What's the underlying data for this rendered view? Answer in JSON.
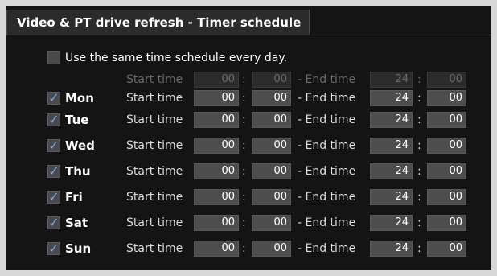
{
  "title": "Video & PT drive refresh - Timer schedule",
  "same_schedule": {
    "label": "Use the same time schedule every day.",
    "checked": false,
    "start_label": "Start time",
    "start_hour": "00",
    "start_minute": "00",
    "end_label": "- End time",
    "end_hour": "24",
    "end_minute": "00",
    "colon": ":"
  },
  "days": [
    {
      "name": "Mon",
      "checked": true,
      "start_label": "Start time",
      "start_hour": "00",
      "start_minute": "00",
      "end_label": "- End time",
      "end_hour": "24",
      "end_minute": "00",
      "colon": ":"
    },
    {
      "name": "Tue",
      "checked": true,
      "start_label": "Start time",
      "start_hour": "00",
      "start_minute": "00",
      "end_label": "- End time",
      "end_hour": "24",
      "end_minute": "00",
      "colon": ":"
    },
    {
      "name": "Wed",
      "checked": true,
      "start_label": "Start time",
      "start_hour": "00",
      "start_minute": "00",
      "end_label": "- End time",
      "end_hour": "24",
      "end_minute": "00",
      "colon": ":"
    },
    {
      "name": "Thu",
      "checked": true,
      "start_label": "Start time",
      "start_hour": "00",
      "start_minute": "00",
      "end_label": "- End time",
      "end_hour": "24",
      "end_minute": "00",
      "colon": ":"
    },
    {
      "name": "Fri",
      "checked": true,
      "start_label": "Start time",
      "start_hour": "00",
      "start_minute": "00",
      "end_label": "- End time",
      "end_hour": "24",
      "end_minute": "00",
      "colon": ":"
    },
    {
      "name": "Sat",
      "checked": true,
      "start_label": "Start time",
      "start_hour": "00",
      "start_minute": "00",
      "end_label": "- End time",
      "end_hour": "24",
      "end_minute": "00",
      "colon": ":"
    },
    {
      "name": "Sun",
      "checked": true,
      "start_label": "Start time",
      "start_hour": "00",
      "start_minute": "00",
      "end_label": "- End time",
      "end_hour": "24",
      "end_minute": "00",
      "colon": ":"
    }
  ],
  "colors": {
    "panel_bg": "#141414",
    "field_bg": "#4d4d4d",
    "check_accent": "#6aa6ff",
    "text": "#ffffff",
    "dim_text": "#6a6a6a"
  }
}
